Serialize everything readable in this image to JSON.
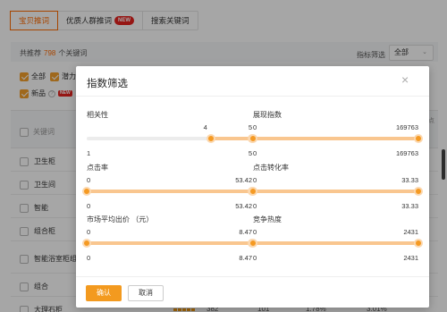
{
  "tabs": [
    {
      "label": "宝贝推词",
      "active": true
    },
    {
      "label": "优质人群推词",
      "badge": "NEW"
    },
    {
      "label": "搜索关键词"
    }
  ],
  "summary": {
    "prefix": "共推荐",
    "count": "798",
    "suffix": "个关键词"
  },
  "filter": {
    "label": "指标筛选",
    "selected": "全部"
  },
  "checkboxes": {
    "all": "全部",
    "potential": "潜力",
    "new_item": "新品",
    "new_tag": "NEW"
  },
  "table": {
    "header_keyword": "关键词",
    "rows": [
      "卫生柜",
      "卫生间",
      "智能",
      "组合柜",
      "智能浴室柜组",
      "组合",
      "大理石柜"
    ],
    "right_edge_header": "点"
  },
  "partial_values": {
    "a": "382",
    "b": "101",
    "c": "1.78%",
    "d": "3.01%"
  },
  "modal": {
    "title": "指数筛选",
    "close_glyph": "×",
    "sliders": [
      {
        "name": "相关性",
        "min": "1",
        "max": "5",
        "low": "4",
        "high": "5",
        "low_frac": 0.75,
        "high_frac": 1.0
      },
      {
        "name": "展现指数",
        "min": "0",
        "max": "169763",
        "low": "0",
        "high": "169763",
        "low_frac": 0.0,
        "high_frac": 1.0
      },
      {
        "name": "点击率",
        "min": "0",
        "max": "53.42",
        "low": "0",
        "high": "53.42",
        "low_frac": 0.0,
        "high_frac": 1.0
      },
      {
        "name": "点击转化率",
        "min": "0",
        "max": "33.33",
        "low": "0",
        "high": "33.33",
        "low_frac": 0.0,
        "high_frac": 1.0
      },
      {
        "name": "市场平均出价 （元）",
        "min": "0",
        "max": "8.47",
        "low": "0",
        "high": "8.47",
        "low_frac": 0.0,
        "high_frac": 1.0
      },
      {
        "name": "竞争热度",
        "min": "0",
        "max": "2431",
        "low": "0",
        "high": "2431",
        "low_frac": 0.0,
        "high_frac": 1.0
      }
    ],
    "ok_label": "确认",
    "cancel_label": "取消"
  },
  "colors": {
    "accent": "#ff6a00",
    "slider_knob": "#f59a23",
    "slider_fill": "#f9c68f",
    "ok_button": "#f39a1f"
  }
}
